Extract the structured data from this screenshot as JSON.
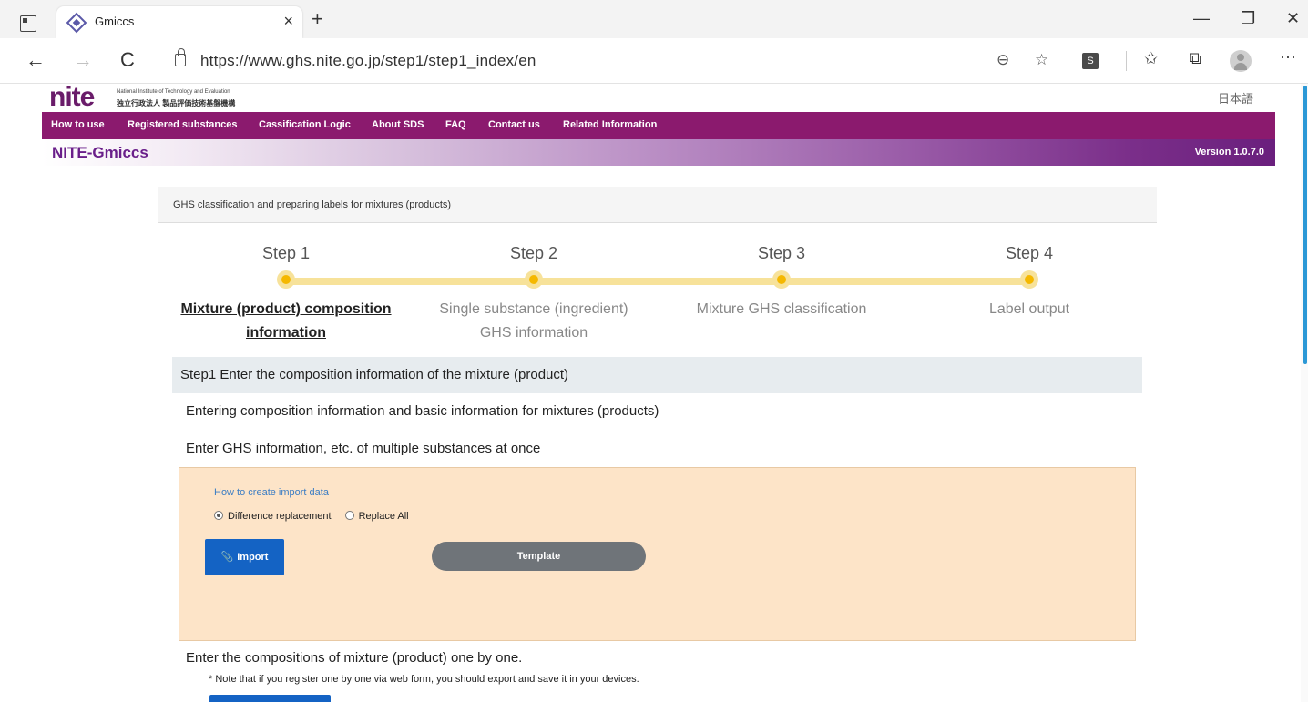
{
  "browser": {
    "tab_title": "Gmiccs",
    "tab_close": "×",
    "new_tab": "+",
    "url": "https://www.ghs.nite.go.jp/step1/step1_index/en",
    "window_minimize": "—",
    "window_restore": "❐",
    "window_close": "✕",
    "back": "←",
    "forward": "→",
    "reload": "C",
    "zoom_icon": "⊖",
    "favorite_icon": "☆",
    "extension_label": "S",
    "favorites_icon": "✩",
    "collections_icon": "⧉",
    "more": "···"
  },
  "site": {
    "logo_mark": "nite",
    "logo_en": "National Institute of Technology and Evaluation",
    "logo_jp": "独立行政法人 製品評価技術基盤機構",
    "language_link": "日本語",
    "menu": [
      "How to use",
      "Registered substances",
      "Cassification Logic",
      "About SDS",
      "FAQ",
      "Contact us",
      "Related Information"
    ],
    "app_title": "NITE-Gmiccs",
    "version": "Version 1.0.7.0"
  },
  "breadcrumb": "GHS classification and preparing labels for mixtures (products)",
  "steps": [
    {
      "num": "Step 1",
      "label_line1": "Mixture (product) composition",
      "label_line2": "information",
      "active": true
    },
    {
      "num": "Step 2",
      "label_line1": "Single substance (ingredient)",
      "label_line2": "GHS information",
      "active": false
    },
    {
      "num": "Step 3",
      "label_line1": "Mixture GHS classification",
      "label_line2": "",
      "active": false
    },
    {
      "num": "Step 4",
      "label_line1": "Label output",
      "label_line2": "",
      "active": false
    }
  ],
  "section_title": "Step1 Enter the composition information of the mixture (product)",
  "intro_text": "Entering composition information and basic information for mixtures (products)",
  "bulk_heading": "Enter GHS information, etc. of multiple substances at once",
  "import_panel": {
    "help_link": "How to create import data",
    "radio_1": "Difference replacement",
    "radio_2": "Replace All",
    "import_button": "Import",
    "template_button": "Template"
  },
  "single_heading": "Enter the compositions of mixture (product) one by one.",
  "note": "* Note that if you register one by one via web form, you should export and save it in your devices.",
  "colors": {
    "menu_bg": "#8b1a6e",
    "primary_button": "#1463c4",
    "panel_bg": "#fde4c8",
    "step_track": "#f7e29a",
    "step_dot": "#f5b800"
  }
}
